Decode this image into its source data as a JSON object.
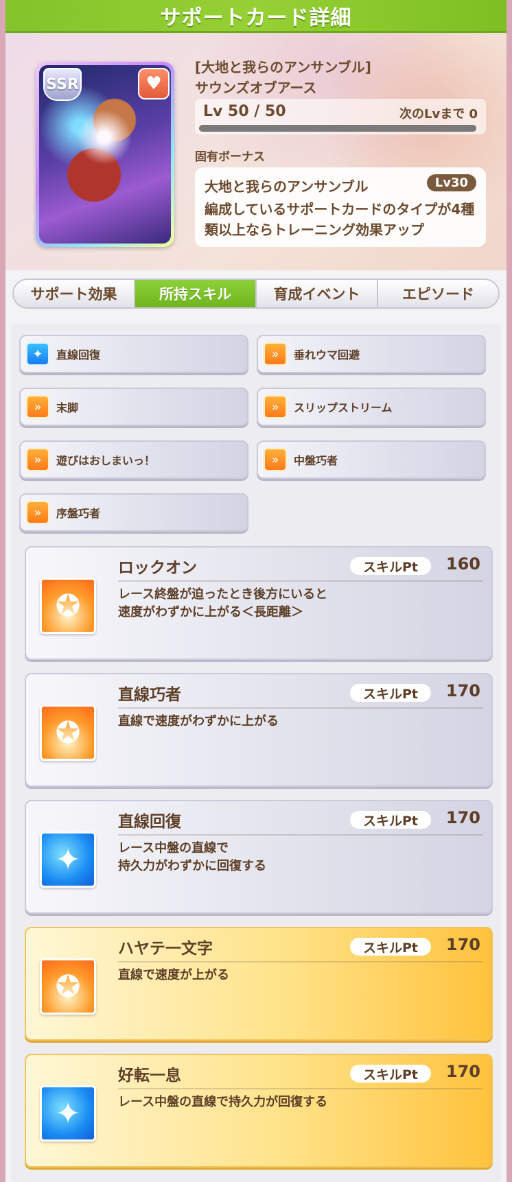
{
  "title": "サポートカード詳細",
  "card": {
    "rarity": "SSR",
    "favorite_icon": "heart-icon",
    "title": "[大地と我らのアンサンブル]",
    "name": "サウンズオブアース",
    "level": "Lv 50 / 50",
    "next_level": "次のLvまで 0",
    "level_progress": 1.0
  },
  "bonus": {
    "section_label": "固有ボーナス",
    "name": "大地と我らのアンサンブル",
    "level": "Lv30",
    "description": "編成しているサポートカードのタイプが4種類以上ならトレーニング効果アップ"
  },
  "tabs": [
    {
      "label": "サポート効果",
      "active": false
    },
    {
      "label": "所持スキル",
      "active": true
    },
    {
      "label": "育成イベント",
      "active": false
    },
    {
      "label": "エピソード",
      "active": false
    }
  ],
  "hint_skills": [
    {
      "label": "直線回復",
      "icon": "blue-sparkle-icon",
      "color": "blue"
    },
    {
      "label": "垂れウマ回避",
      "icon": "orange-runner-icon",
      "color": "orange"
    },
    {
      "label": "末脚",
      "icon": "orange-runner-icon",
      "color": "orange"
    },
    {
      "label": "スリップストリーム",
      "icon": "orange-runner-icon",
      "color": "orange"
    },
    {
      "label": "遊びはおしまいっ！",
      "icon": "orange-runner-icon",
      "color": "orange"
    },
    {
      "label": "中盤巧者",
      "icon": "orange-runner-icon",
      "color": "orange"
    },
    {
      "label": "序盤巧者",
      "icon": "orange-runner-icon",
      "color": "orange"
    }
  ],
  "skills": [
    {
      "name": "ロックオン",
      "pt_label": "スキルPt",
      "pt": "160",
      "description": "レース終盤が迫ったとき後方にいると\n速度がわずかに上がる＜長距離＞",
      "icon": "orange-runner-icon",
      "rarity": "normal"
    },
    {
      "name": "直線巧者",
      "pt_label": "スキルPt",
      "pt": "170",
      "description": "直線で速度がわずかに上がる",
      "icon": "orange-runner-icon",
      "rarity": "normal"
    },
    {
      "name": "直線回復",
      "pt_label": "スキルPt",
      "pt": "170",
      "description": "レース中盤の直線で\n持久力がわずかに回復する",
      "icon": "blue-sparkle-icon",
      "rarity": "normal"
    },
    {
      "name": "ハヤテ一文字",
      "pt_label": "スキルPt",
      "pt": "170",
      "description": "直線で速度が上がる",
      "icon": "orange-runner-icon",
      "rarity": "gold"
    },
    {
      "name": "好転一息",
      "pt_label": "スキルPt",
      "pt": "170",
      "description": "レース中盤の直線で持久力が回復する",
      "icon": "blue-sparkle-icon",
      "rarity": "gold"
    }
  ],
  "colors": {
    "accent_green": "#83c42b",
    "text_brown": "#6b4a2e",
    "gold": "#ffc23d",
    "skill_orange": "#ff8a1f",
    "skill_blue": "#1a8cf3"
  }
}
